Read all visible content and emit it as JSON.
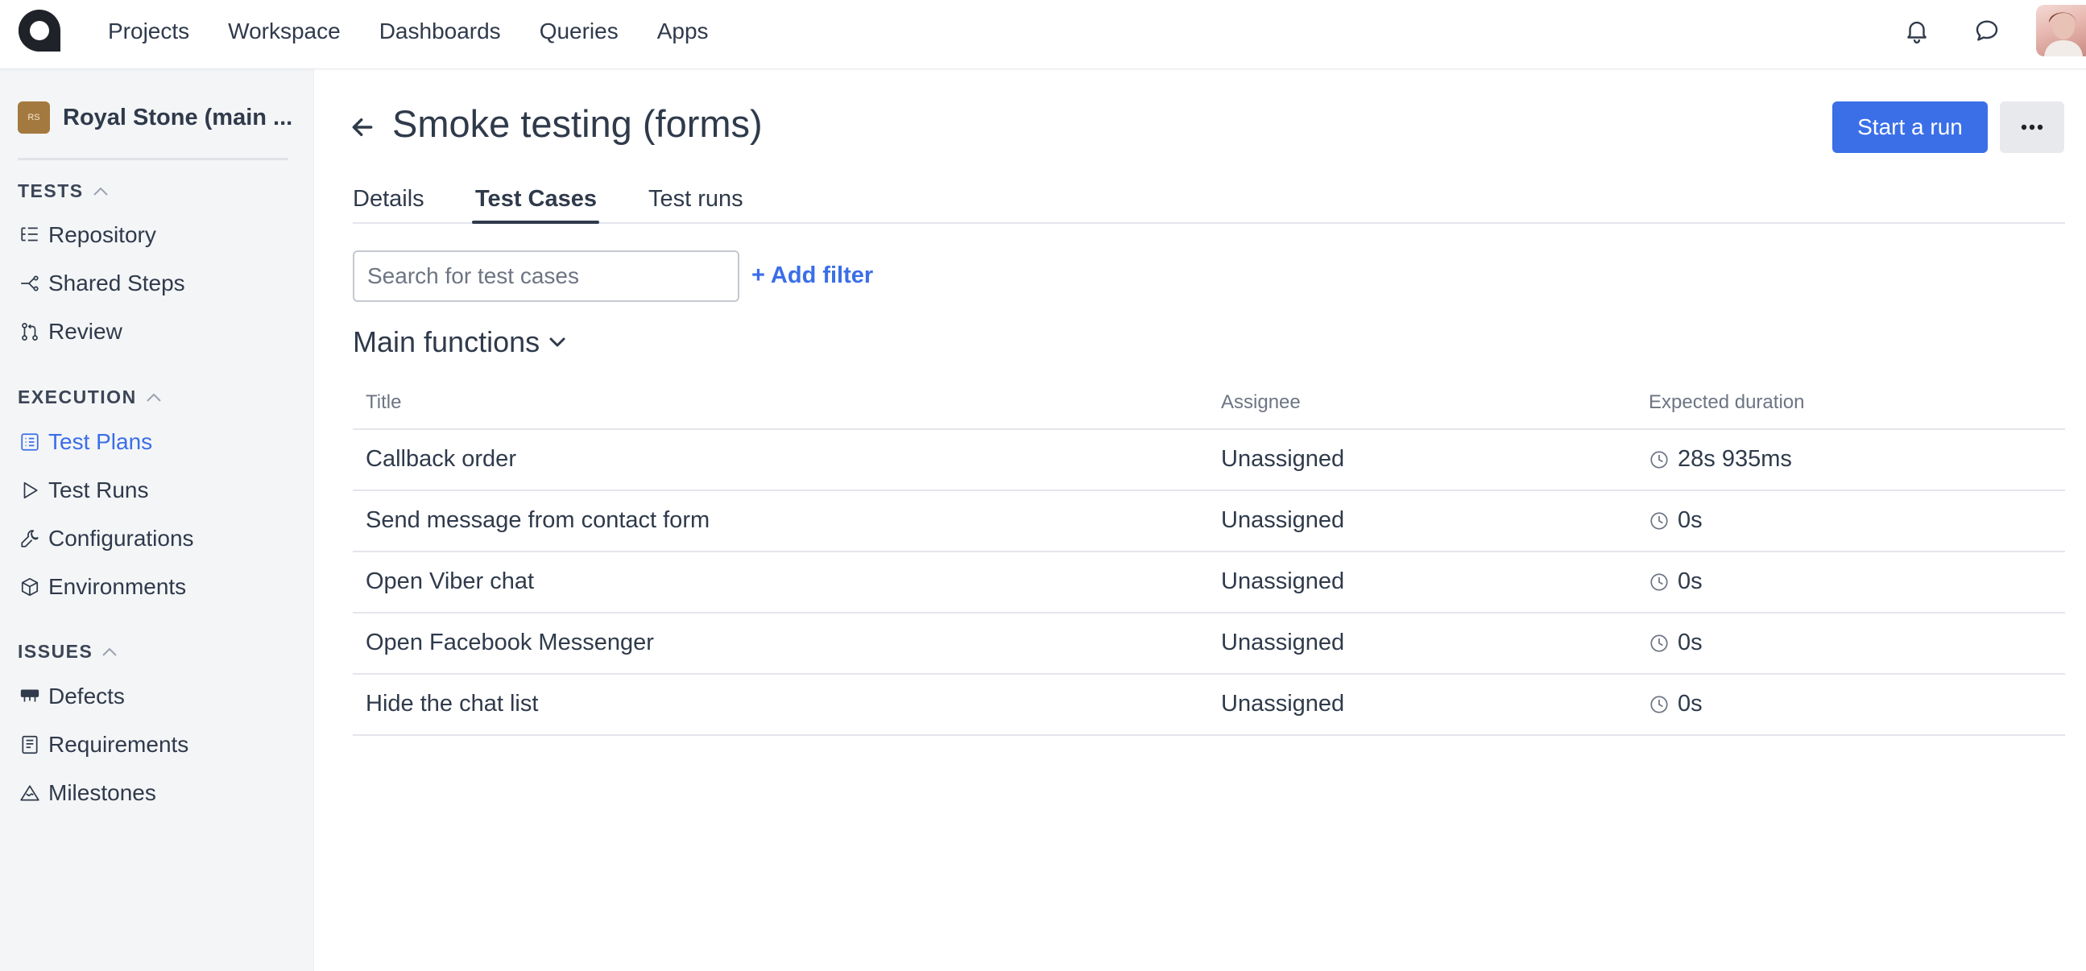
{
  "topnav": {
    "items": [
      "Projects",
      "Workspace",
      "Dashboards",
      "Queries",
      "Apps"
    ],
    "icons": [
      "bell-icon",
      "chat-icon"
    ]
  },
  "sidebar": {
    "project_badge": "RS",
    "project_name": "Royal Stone (main ...",
    "sections": {
      "tests": {
        "title": "TESTS",
        "items": [
          "Repository",
          "Shared Steps",
          "Review"
        ]
      },
      "execution": {
        "title": "EXECUTION",
        "items": [
          "Test Plans",
          "Test Runs",
          "Configurations",
          "Environments"
        ]
      },
      "issues": {
        "title": "ISSUES",
        "items": [
          "Defects",
          "Requirements",
          "Milestones"
        ]
      }
    },
    "active_item": "Test Plans"
  },
  "header": {
    "title": "Smoke testing (forms)",
    "start_button": "Start a run"
  },
  "tabs": [
    "Details",
    "Test Cases",
    "Test runs"
  ],
  "active_tab": "Test Cases",
  "search": {
    "placeholder": "Search for test cases",
    "value": ""
  },
  "add_filter_label": "+ Add filter",
  "group": {
    "title": "Main functions"
  },
  "table": {
    "columns": [
      "Title",
      "Assignee",
      "Expected duration"
    ],
    "rows": [
      {
        "title": "Callback order",
        "assignee": "Unassigned",
        "duration": "28s 935ms"
      },
      {
        "title": "Send message from contact form",
        "assignee": "Unassigned",
        "duration": "0s"
      },
      {
        "title": "Open Viber chat",
        "assignee": "Unassigned",
        "duration": "0s"
      },
      {
        "title": "Open Facebook Messenger",
        "assignee": "Unassigned",
        "duration": "0s"
      },
      {
        "title": "Hide the chat list",
        "assignee": "Unassigned",
        "duration": "0s"
      }
    ]
  },
  "colors": {
    "accent": "#3b6fe8",
    "text": "#2f3a4b",
    "sidebar_bg": "#f4f5f7",
    "project_badge": "#a4793f"
  }
}
